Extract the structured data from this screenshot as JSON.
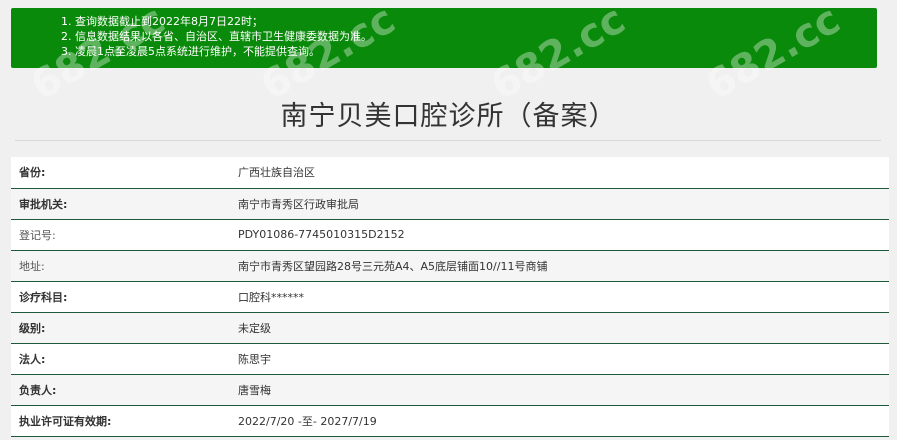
{
  "notice": {
    "items": [
      "查询数据截止到2022年8月7日22时；",
      "信息数据结果以各省、自治区、直辖市卫生健康委数据为准。",
      "凌晨1点至凌晨5点系统进行维护，不能提供查询。"
    ],
    "bg_color": "#0a8a0a"
  },
  "title": "南宁贝美口腔诊所（备案）",
  "rows": [
    {
      "label": "省份:",
      "value": "广西壮族自治区"
    },
    {
      "label": "审批机关:",
      "value": "南宁市青秀区行政审批局"
    },
    {
      "label": "登记号:",
      "value": "PDY01086-7745010315D2152"
    },
    {
      "label": "地址:",
      "value": "南宁市青秀区望园路28号三元苑A4、A5底层铺面10//11号商铺"
    },
    {
      "label": "诊疗科目:",
      "value": "口腔科******"
    },
    {
      "label": "级别:",
      "value": "未定级"
    },
    {
      "label": "法人:",
      "value": "陈思宇"
    },
    {
      "label": "负责人:",
      "value": "唐雪梅"
    },
    {
      "label": "执业许可证有效期:",
      "value": "2022/7/20 -至- 2027/7/19"
    }
  ],
  "watermark_text": "682.cc"
}
